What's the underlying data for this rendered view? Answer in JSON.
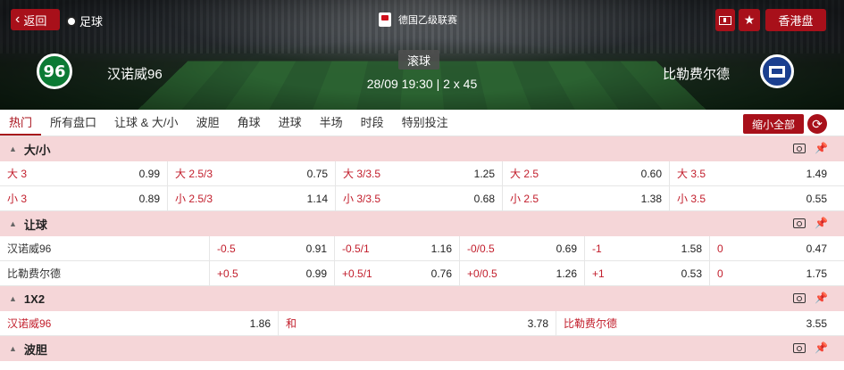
{
  "header": {
    "back_label": "返回",
    "sport_label": "足球",
    "league": "德国乙级联赛",
    "odds_format": "香港盘",
    "live_label": "滚球",
    "match_time": "28/09 19:30 | 2 x 45",
    "home_team": "汉诺威96",
    "home_logo_text": "96",
    "away_team": "比勒费尔德"
  },
  "tabs": [
    "热门",
    "所有盘口",
    "让球 & 大/小",
    "波胆",
    "角球",
    "进球",
    "半场",
    "时段",
    "特别投注"
  ],
  "collapse_label": "缩小全部",
  "sections": {
    "ou": {
      "title": "大/小",
      "rows": [
        [
          {
            "label": "大 3",
            "odd": "0.99"
          },
          {
            "label": "大 2.5/3",
            "odd": "0.75"
          },
          {
            "label": "大 3/3.5",
            "odd": "1.25"
          },
          {
            "label": "大 2.5",
            "odd": "0.60"
          },
          {
            "label": "大 3.5",
            "odd": "1.49"
          }
        ],
        [
          {
            "label": "小 3",
            "odd": "0.89"
          },
          {
            "label": "小 2.5/3",
            "odd": "1.14"
          },
          {
            "label": "小 3/3.5",
            "odd": "0.68"
          },
          {
            "label": "小 2.5",
            "odd": "1.38"
          },
          {
            "label": "小 3.5",
            "odd": "0.55"
          }
        ]
      ]
    },
    "handicap": {
      "title": "让球",
      "rows": [
        {
          "team": "汉诺威96",
          "cells": [
            {
              "label": "-0.5",
              "odd": "0.91"
            },
            {
              "label": "-0.5/1",
              "odd": "1.16"
            },
            {
              "label": "-0/0.5",
              "odd": "0.69"
            },
            {
              "label": "-1",
              "odd": "1.58"
            },
            {
              "label": "0",
              "odd": "0.47"
            }
          ]
        },
        {
          "team": "比勒费尔德",
          "cells": [
            {
              "label": "+0.5",
              "odd": "0.99"
            },
            {
              "label": "+0.5/1",
              "odd": "0.76"
            },
            {
              "label": "+0/0.5",
              "odd": "1.26"
            },
            {
              "label": "+1",
              "odd": "0.53"
            },
            {
              "label": "0",
              "odd": "1.75"
            }
          ]
        }
      ]
    },
    "x12": {
      "title": "1X2",
      "cells": [
        {
          "label": "汉诺威96",
          "odd": "1.86"
        },
        {
          "label": "和",
          "odd": "3.78"
        },
        {
          "label": "比勒费尔德",
          "odd": "3.55"
        }
      ]
    },
    "cs": {
      "title": "波胆"
    }
  }
}
